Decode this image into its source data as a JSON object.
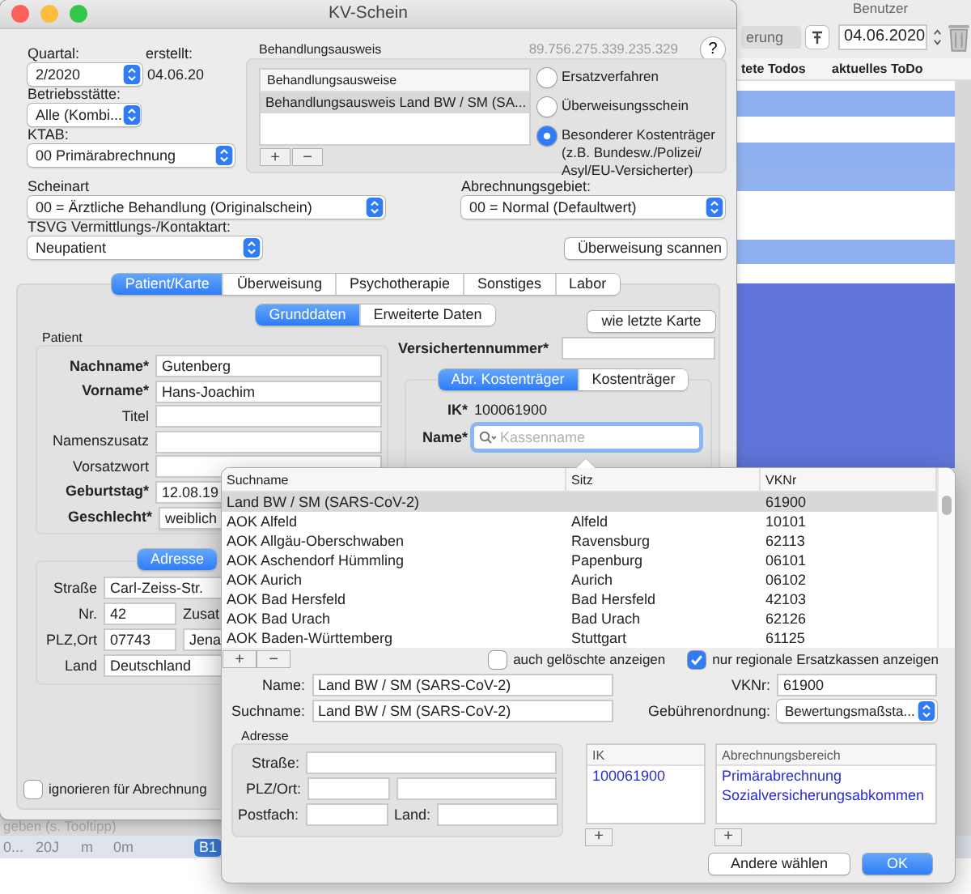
{
  "background_app": {
    "user_label": "Benutzer",
    "filter_field": "erung",
    "date": "04.06.2020",
    "columns": [
      "tete Todos",
      "aktuelles ToDo"
    ],
    "footer_hint": "geben (s. Tooltipp)",
    "footer_cells": [
      "0...",
      "20J",
      "m",
      "0m"
    ],
    "footer_badge": "B1"
  },
  "window": {
    "title": "KV-Schein",
    "ip": "89.756.275.339.235.329",
    "help": "?",
    "quartal": {
      "label": "Quartal:",
      "value": "2/2020"
    },
    "erstellt": {
      "label": "erstellt:",
      "value": "04.06.20"
    },
    "betriebsstaette": {
      "label": "Betriebsstätte:",
      "value": "Alle (Kombi..."
    },
    "ktab": {
      "label": "KTAB:",
      "value": "00 Primärabrechnung"
    },
    "behandlungsausweis": {
      "title": "Behandlungsausweis",
      "column": "Behandlungsausweise",
      "rows": [
        {
          "text": "Behandlungsausweis Land BW / SM (SA...",
          "selected": true
        }
      ],
      "add": "+",
      "remove": "−"
    },
    "radios": [
      {
        "label": "Ersatzverfahren",
        "selected": false
      },
      {
        "label": "Überweisungsschein",
        "selected": false
      },
      {
        "label": "Besonderer Kostenträger (z.B. Bundesw./Polizei/ Asyl/EU-Versicherter)",
        "selected": true
      }
    ],
    "scheinart": {
      "label": "Scheinart",
      "value": "00 = Ärztliche Behandlung (Originalschein)"
    },
    "abrechnungsgebiet": {
      "label": "Abrechnungsgebiet:",
      "value": "00 = Normal (Defaultwert)"
    },
    "tsvg": {
      "label": "TSVG Vermittlungs-/Kontaktart:",
      "value": "Neupatient"
    },
    "scan_button": "Überweisung scannen",
    "tabs": [
      {
        "label": "Patient/Karte",
        "selected": true
      },
      {
        "label": "Überweisung",
        "selected": false
      },
      {
        "label": "Psychotherapie",
        "selected": false
      },
      {
        "label": "Sonstiges",
        "selected": false
      },
      {
        "label": "Labor",
        "selected": false
      }
    ],
    "subtabs": [
      {
        "label": "Grunddaten",
        "selected": true
      },
      {
        "label": "Erweiterte Daten",
        "selected": false
      }
    ],
    "last_card_button": "wie letzte Karte",
    "patient": {
      "title": "Patient",
      "fields": [
        {
          "label": "Nachname*",
          "value": "Gutenberg",
          "required": true,
          "kind": "text"
        },
        {
          "label": "Vorname*",
          "value": "Hans-Joachim",
          "required": true,
          "kind": "text"
        },
        {
          "label": "Titel",
          "required": false,
          "kind": "text"
        },
        {
          "label": "Namenszusatz",
          "required": false,
          "kind": "text"
        },
        {
          "label": "Vorsatzwort",
          "required": false,
          "kind": "text"
        },
        {
          "label": "Geburtstag*",
          "value": "12.08.19",
          "required": true,
          "kind": "text"
        },
        {
          "label": "Geschlecht*",
          "value": "weiblich",
          "required": true,
          "kind": "select"
        }
      ]
    },
    "versichertennummer": {
      "label": "Versichertennummer*"
    },
    "kostentraeger_tabs": [
      {
        "label": "Abr. Kostenträger",
        "selected": true
      },
      {
        "label": "Kostenträger",
        "selected": false
      }
    ],
    "ik": {
      "label": "IK*",
      "value": "100061900"
    },
    "name_search": {
      "label": "Name*",
      "placeholder": "Kassenname"
    },
    "address_tabs": [
      {
        "label": "Adresse",
        "selected": true
      }
    ],
    "address": {
      "strasse": {
        "label": "Straße",
        "value": "Carl-Zeiss-Str."
      },
      "nr": {
        "label": "Nr.",
        "value": "42"
      },
      "zusatz_label": "Zusat",
      "plz_ort": {
        "label": "PLZ,Ort",
        "plz": "07743",
        "ort": "Jena"
      },
      "land": {
        "label": "Land",
        "value": "Deutschland"
      }
    },
    "ignore_checkbox": {
      "label": "ignorieren für Abrechnung",
      "checked": false
    }
  },
  "popup": {
    "columns": [
      "Suchname",
      "Sitz",
      "VKNr"
    ],
    "rows": [
      {
        "suchname": "Land BW / SM (SARS-CoV-2)",
        "vknr": "61900",
        "selected": true
      },
      {
        "suchname": "AOK Alfeld",
        "sitz": "Alfeld",
        "vknr": "10101",
        "selected": false
      },
      {
        "suchname": "AOK Allgäu-Oberschwaben",
        "sitz": "Ravensburg",
        "vknr": "62113",
        "selected": false
      },
      {
        "suchname": "AOK Aschendorf Hümmling",
        "sitz": "Papenburg",
        "vknr": "06101",
        "selected": false
      },
      {
        "suchname": "AOK Aurich",
        "sitz": "Aurich",
        "vknr": "06102",
        "selected": false
      },
      {
        "suchname": "AOK Bad Hersfeld",
        "sitz": "Bad Hersfeld",
        "vknr": "42103",
        "selected": false
      },
      {
        "suchname": "AOK Bad Urach",
        "sitz": "Bad Urach",
        "vknr": "62126",
        "selected": false
      },
      {
        "suchname": "AOK Baden-Württemberg",
        "sitz": "Stuttgart",
        "vknr": "61125",
        "selected": false
      }
    ],
    "add": "+",
    "remove": "−",
    "show_deleted": {
      "label": "auch gelöschte anzeigen",
      "checked": false
    },
    "regional_only": {
      "label": "nur regionale Ersatzkassen anzeigen",
      "checked": true
    },
    "name": {
      "label": "Name:",
      "value": "Land BW / SM (SARS-CoV-2)"
    },
    "suchname": {
      "label": "Suchname:",
      "value": "Land BW / SM (SARS-CoV-2)"
    },
    "vknr": {
      "label": "VKNr:",
      "value": "61900"
    },
    "gebuehrenordnung": {
      "label": "Gebührenordnung:",
      "value": "Bewertungsmaßsta..."
    },
    "address": {
      "title": "Adresse",
      "strasse": "Straße:",
      "plz_ort": "PLZ/Ort:",
      "postfach": "Postfach:",
      "land": "Land:"
    },
    "ik_table": {
      "column": "IK",
      "rows": [
        "100061900"
      ],
      "add": "+"
    },
    "bereich_table": {
      "column": "Abrechnungsbereich",
      "rows": [
        "Primärabrechnung",
        "Sozialversicherungsabkommen"
      ],
      "add": "+"
    },
    "buttons": [
      {
        "label": "Andere wählen",
        "kind": "secondary"
      },
      {
        "label": "OK",
        "kind": "default"
      }
    ]
  }
}
